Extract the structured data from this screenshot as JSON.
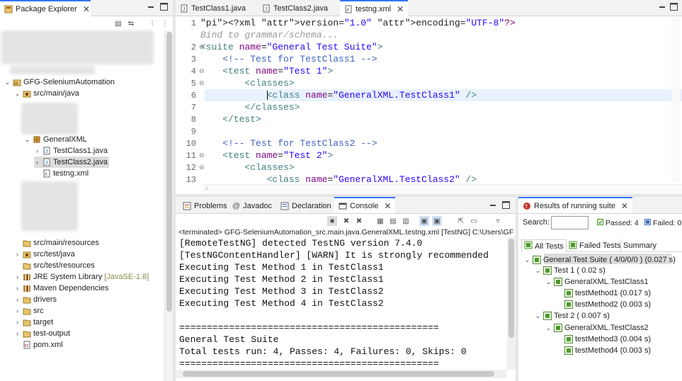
{
  "left": {
    "tab_label": "Package Explorer",
    "tree": [
      {
        "label": "GFG-SeleniumAutomation"
      },
      {
        "label": "src/main/java"
      },
      {
        "label": "GeneralXML"
      },
      {
        "label": "TestClass1.java"
      },
      {
        "label": "TestClass2.java"
      },
      {
        "label": "testng.xml"
      },
      {
        "label": "src/main/resources"
      },
      {
        "label": "src/test/java"
      },
      {
        "label": "src/test/resources"
      },
      {
        "label": "JRE System Library",
        "decoration": "[JavaSE-1.8]"
      },
      {
        "label": "Maven Dependencies"
      },
      {
        "label": "drivers"
      },
      {
        "label": "src"
      },
      {
        "label": "target"
      },
      {
        "label": "test-output"
      },
      {
        "label": "pom.xml"
      }
    ]
  },
  "editor": {
    "tabs": [
      {
        "label": "TestClass1.java"
      },
      {
        "label": "TestClass2.java"
      },
      {
        "label": "testng.xml"
      }
    ],
    "lines": [
      {
        "num": "1",
        "t": "<?xml version=\"1.0\" encoding=\"UTF-8\"?>"
      },
      {
        "num": "",
        "t": "Bind to grammar/schema..."
      },
      {
        "num": "2",
        "t": "<suite name=\"General Test Suite\">"
      },
      {
        "num": "3",
        "t": "    <!-- Test for TestClass1 -->"
      },
      {
        "num": "4",
        "t": "    <test name=\"Test 1\">"
      },
      {
        "num": "5",
        "t": "        <classes>"
      },
      {
        "num": "6",
        "t": "            <class name=\"GeneralXML.TestClass1\" />"
      },
      {
        "num": "7",
        "t": "        </classes>"
      },
      {
        "num": "8",
        "t": "    </test>"
      },
      {
        "num": "9",
        "t": ""
      },
      {
        "num": "10",
        "t": "    <!-- Test for TestClass2 -->"
      },
      {
        "num": "11",
        "t": "    <test name=\"Test 2\">"
      },
      {
        "num": "12",
        "t": "        <classes>"
      },
      {
        "num": "13",
        "t": "            <class name=\"GeneralXML.TestClass2\" />"
      }
    ]
  },
  "bottom": {
    "tabs": [
      {
        "label": "Problems"
      },
      {
        "label": "Javadoc"
      },
      {
        "label": "Declaration"
      },
      {
        "label": "Console"
      }
    ],
    "terminated": "<terminated> GFG-SeleniumAutomation_src.main.java.GeneralXML.testng.xml [TestNG] C:\\Users\\GF",
    "console_lines": [
      "[RemoteTestNG] detected TestNG version 7.4.0",
      "[TestNGContentHandler] [WARN] It is strongly recommended",
      "Executing Test Method 1 in TestClass1",
      "Executing Test Method 2 in TestClass1",
      "Executing Test Method 3 in TestClass2",
      "Executing Test Method 4 in TestClass2",
      "",
      "===============================================",
      "General Test Suite",
      "Total tests run: 4, Passes: 4, Failures: 0, Skips: 0",
      "==============================================="
    ]
  },
  "results": {
    "tab_label": "Results of running suite",
    "search_label": "Search:",
    "search_value": "",
    "passed": "Passed: 4",
    "failed": "Failed: 0",
    "subtabs": [
      {
        "label": "All Tests"
      },
      {
        "label": "Failed Tests"
      },
      {
        "label": "Summary"
      }
    ],
    "tree": [
      {
        "label": "General Test Suite ( 4/0/0/0 ) (0.027 s)"
      },
      {
        "label": "Test 1 ( 0.02 s)"
      },
      {
        "label": "GeneralXML.TestClass1"
      },
      {
        "label": "testMethod1  (0.017 s)"
      },
      {
        "label": "testMethod2  (0.003 s)"
      },
      {
        "label": "Test 2 ( 0.007 s)"
      },
      {
        "label": "GeneralXML.TestClass2"
      },
      {
        "label": "testMethod3  (0.004 s)"
      },
      {
        "label": "testMethod4  (0.003 s)"
      }
    ]
  }
}
